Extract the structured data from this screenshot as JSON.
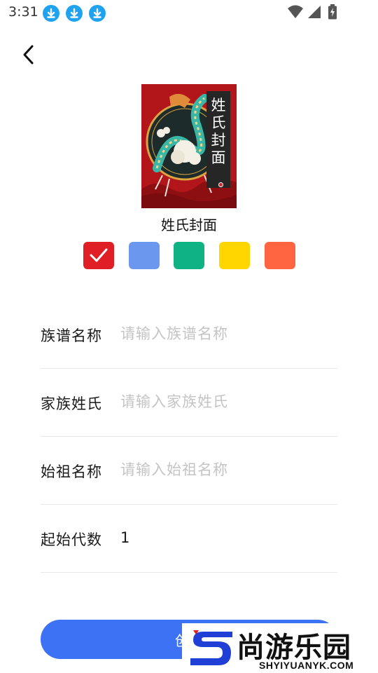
{
  "status_bar": {
    "time": "3:31",
    "notification_icons": [
      "download-icon",
      "download-icon",
      "download-icon"
    ],
    "system_icons": [
      "wifi-icon",
      "cellular-signal-icon",
      "battery-charging-icon"
    ]
  },
  "header": {
    "back_icon": "chevron-left-icon"
  },
  "cover": {
    "title_chars": [
      "姓",
      "氏",
      "封",
      "面"
    ],
    "caption": "姓氏封面"
  },
  "color_options": {
    "selected_index": 0,
    "swatches": [
      "#e01e25",
      "#6b98ee",
      "#0eb283",
      "#ffd600",
      "#ff6540"
    ]
  },
  "form": {
    "fields": [
      {
        "label": "族谱名称",
        "placeholder": "请输入族谱名称",
        "value": ""
      },
      {
        "label": "家族姓氏",
        "placeholder": "请输入家族姓氏",
        "value": ""
      },
      {
        "label": "始祖名称",
        "placeholder": "请输入始祖名称",
        "value": ""
      },
      {
        "label": "起始代数",
        "placeholder": "",
        "value": "1"
      }
    ]
  },
  "create_button": {
    "label": "创建"
  },
  "watermark": {
    "title": "尚游乐园",
    "subtitle": "SHYIYUANYK.COM"
  }
}
